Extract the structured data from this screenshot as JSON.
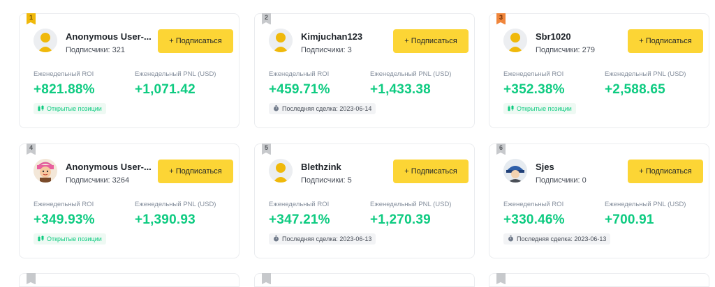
{
  "labels": {
    "subscribe": "+ Подписаться",
    "weekly_roi": "Еженедельный ROI",
    "weekly_pnl": "Еженедельный PNL (USD)",
    "open_positions": "Открытые позиции"
  },
  "colors": {
    "accent": "#fcd535",
    "profit": "#0ecb81",
    "gold": "#f0b90b",
    "silver": "#c7c9cc",
    "bronze": "#f0863c"
  },
  "cards": [
    {
      "rank": "1",
      "name": "Anonymous User-...",
      "subs": "Подписчики: 321",
      "roi": "+821.88%",
      "pnl": "+1,071.42",
      "badge": "Открытые позиции",
      "avatar": "default-avatar-icon"
    },
    {
      "rank": "2",
      "name": "Kimjuchan123",
      "subs": "Подписчики: 3",
      "roi": "+459.71%",
      "pnl": "+1,433.38",
      "badge": "Последняя сделка: 2023-06-14",
      "avatar": "default-avatar-icon"
    },
    {
      "rank": "3",
      "name": "Sbr1020",
      "subs": "Подписчики: 279",
      "roi": "+352.38%",
      "pnl": "+2,588.65",
      "badge": "Открытые позиции",
      "avatar": "default-avatar-icon"
    },
    {
      "rank": "4",
      "name": "Anonymous User-...",
      "subs": "Подписчики: 3264",
      "roi": "+349.93%",
      "pnl": "+1,390.93",
      "badge": "Открытые позиции",
      "avatar": "cartoon-avatar-icon"
    },
    {
      "rank": "5",
      "name": "Blethzink",
      "subs": "Подписчики: 5",
      "roi": "+347.21%",
      "pnl": "+1,270.39",
      "badge": "Последняя сделка: 2023-06-13",
      "avatar": "default-avatar-icon"
    },
    {
      "rank": "6",
      "name": "Sjes",
      "subs": "Подписчики: 0",
      "roi": "+330.46%",
      "pnl": "+700.91",
      "badge": "Последняя сделка: 2023-06-13",
      "avatar": "helmet-avatar-icon"
    }
  ]
}
